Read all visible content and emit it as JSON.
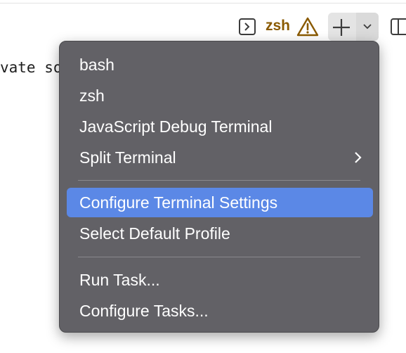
{
  "toolbar": {
    "terminal_name": "zsh",
    "icons": [
      "terminal-icon",
      "warning-icon",
      "plus-icon",
      "chevron-down-icon",
      "split-panel-icon"
    ],
    "warning_color": "#8a5a00"
  },
  "editor": {
    "partial_line": "vate so"
  },
  "menu": {
    "items": [
      {
        "label": "bash"
      },
      {
        "label": "zsh"
      },
      {
        "label": "JavaScript Debug Terminal"
      },
      {
        "label": "Split Terminal"
      },
      {
        "label": "Configure Terminal Settings"
      },
      {
        "label": "Select Default Profile"
      },
      {
        "label": "Run Task..."
      },
      {
        "label": "Configure Tasks..."
      }
    ],
    "highlight_color": "#5b88e6",
    "background_color": "#626166"
  }
}
